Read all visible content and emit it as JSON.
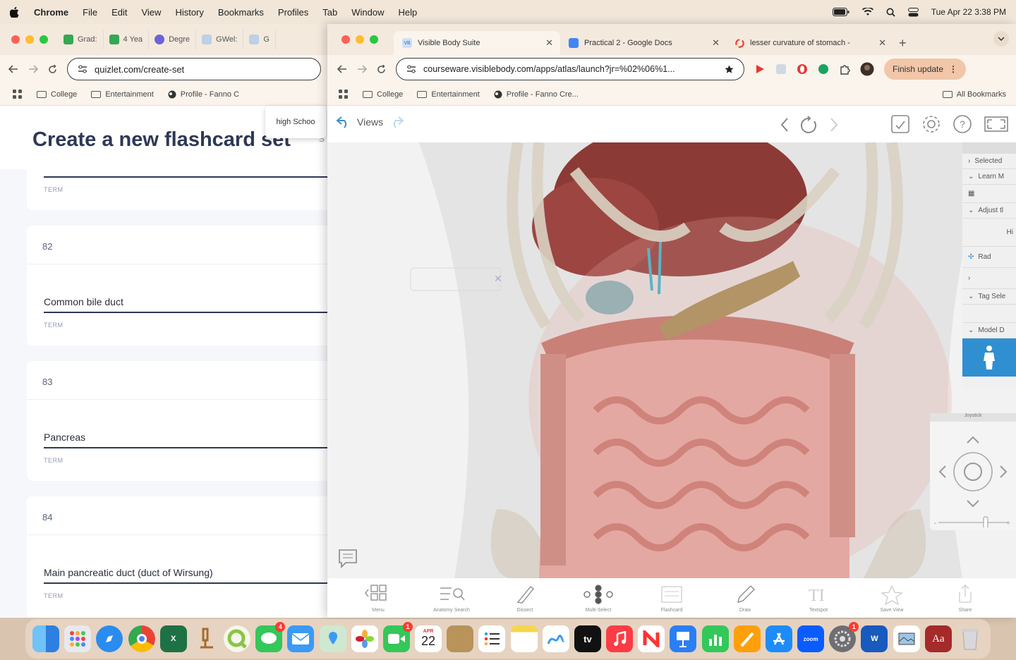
{
  "menubar": {
    "items": [
      "Chrome",
      "File",
      "Edit",
      "View",
      "History",
      "Bookmarks",
      "Profiles",
      "Tab",
      "Window",
      "Help"
    ],
    "datetime": "Tue Apr 22  3:38 PM"
  },
  "left_window": {
    "tabs": [
      "Grad:",
      "4 Yea",
      "Degre",
      "GWel:",
      "G"
    ],
    "url": "quizlet.com/create-set",
    "bookmarks": [
      "College",
      "Entertainment",
      "Profile - Fanno C"
    ],
    "popup": "high Schoo",
    "page_title": "Create a new flashcard set",
    "title_suffix": "S",
    "cards": [
      {
        "num": "",
        "term": "",
        "label": "TERM"
      },
      {
        "num": "82",
        "term": "Common bile duct",
        "label": "TERM"
      },
      {
        "num": "83",
        "term": "Pancreas",
        "label": "TERM"
      },
      {
        "num": "84",
        "term": "Main pancreatic duct (duct of Wirsung)",
        "label": "TERM"
      }
    ]
  },
  "right_window": {
    "tabs": [
      {
        "label": "Visible Body Suite",
        "favicon": "VB"
      },
      {
        "label": "Practical 2 - Google Docs"
      },
      {
        "label": "lesser curvature of stomach -"
      }
    ],
    "new_tab": "+",
    "url": "courseware.visiblebody.com/apps/atlas/launch?jr=%02%06%1...",
    "finish_update": "Finish update",
    "bookmarks": [
      "College",
      "Entertainment",
      "Profile - Fanno Cre..."
    ],
    "all_bookmarks": "All Bookmarks",
    "views_label": "Views",
    "side_panel": [
      "Selected",
      "Learn M",
      "Adjust tl",
      "Hi",
      "Rad",
      "Tag Sele",
      "Model D"
    ],
    "joystick_label": "Joystick",
    "toolbar": [
      "Menu",
      "Anatomy Search",
      "Dissect",
      "Multi-Select",
      "Flashcard",
      "Draw",
      "Textspot",
      "Save View",
      "Share"
    ]
  },
  "dock": {
    "calendar_month": "APR",
    "calendar_day": "22",
    "apps": [
      "Finder",
      "Launchpad",
      "Safari",
      "Chrome",
      "Excel",
      "Microscope",
      "QuickTime",
      "Messages",
      "Mail",
      "Maps",
      "Photos",
      "FaceTime",
      "Calendar",
      "Notes-Brown",
      "Reminders",
      "Notes",
      "Freeform",
      "Apple TV",
      "Music",
      "News",
      "Keynote",
      "Numbers",
      "Pages",
      "App Store",
      "Zoom",
      "Settings",
      "Word",
      "Preview",
      "Dictionary",
      "Trash"
    ],
    "badges": {
      "messages": "4",
      "facetime": "1",
      "settings": "1"
    },
    "tv_label": "tv",
    "zoom_label": "zoom",
    "dict_label": "Aa"
  }
}
